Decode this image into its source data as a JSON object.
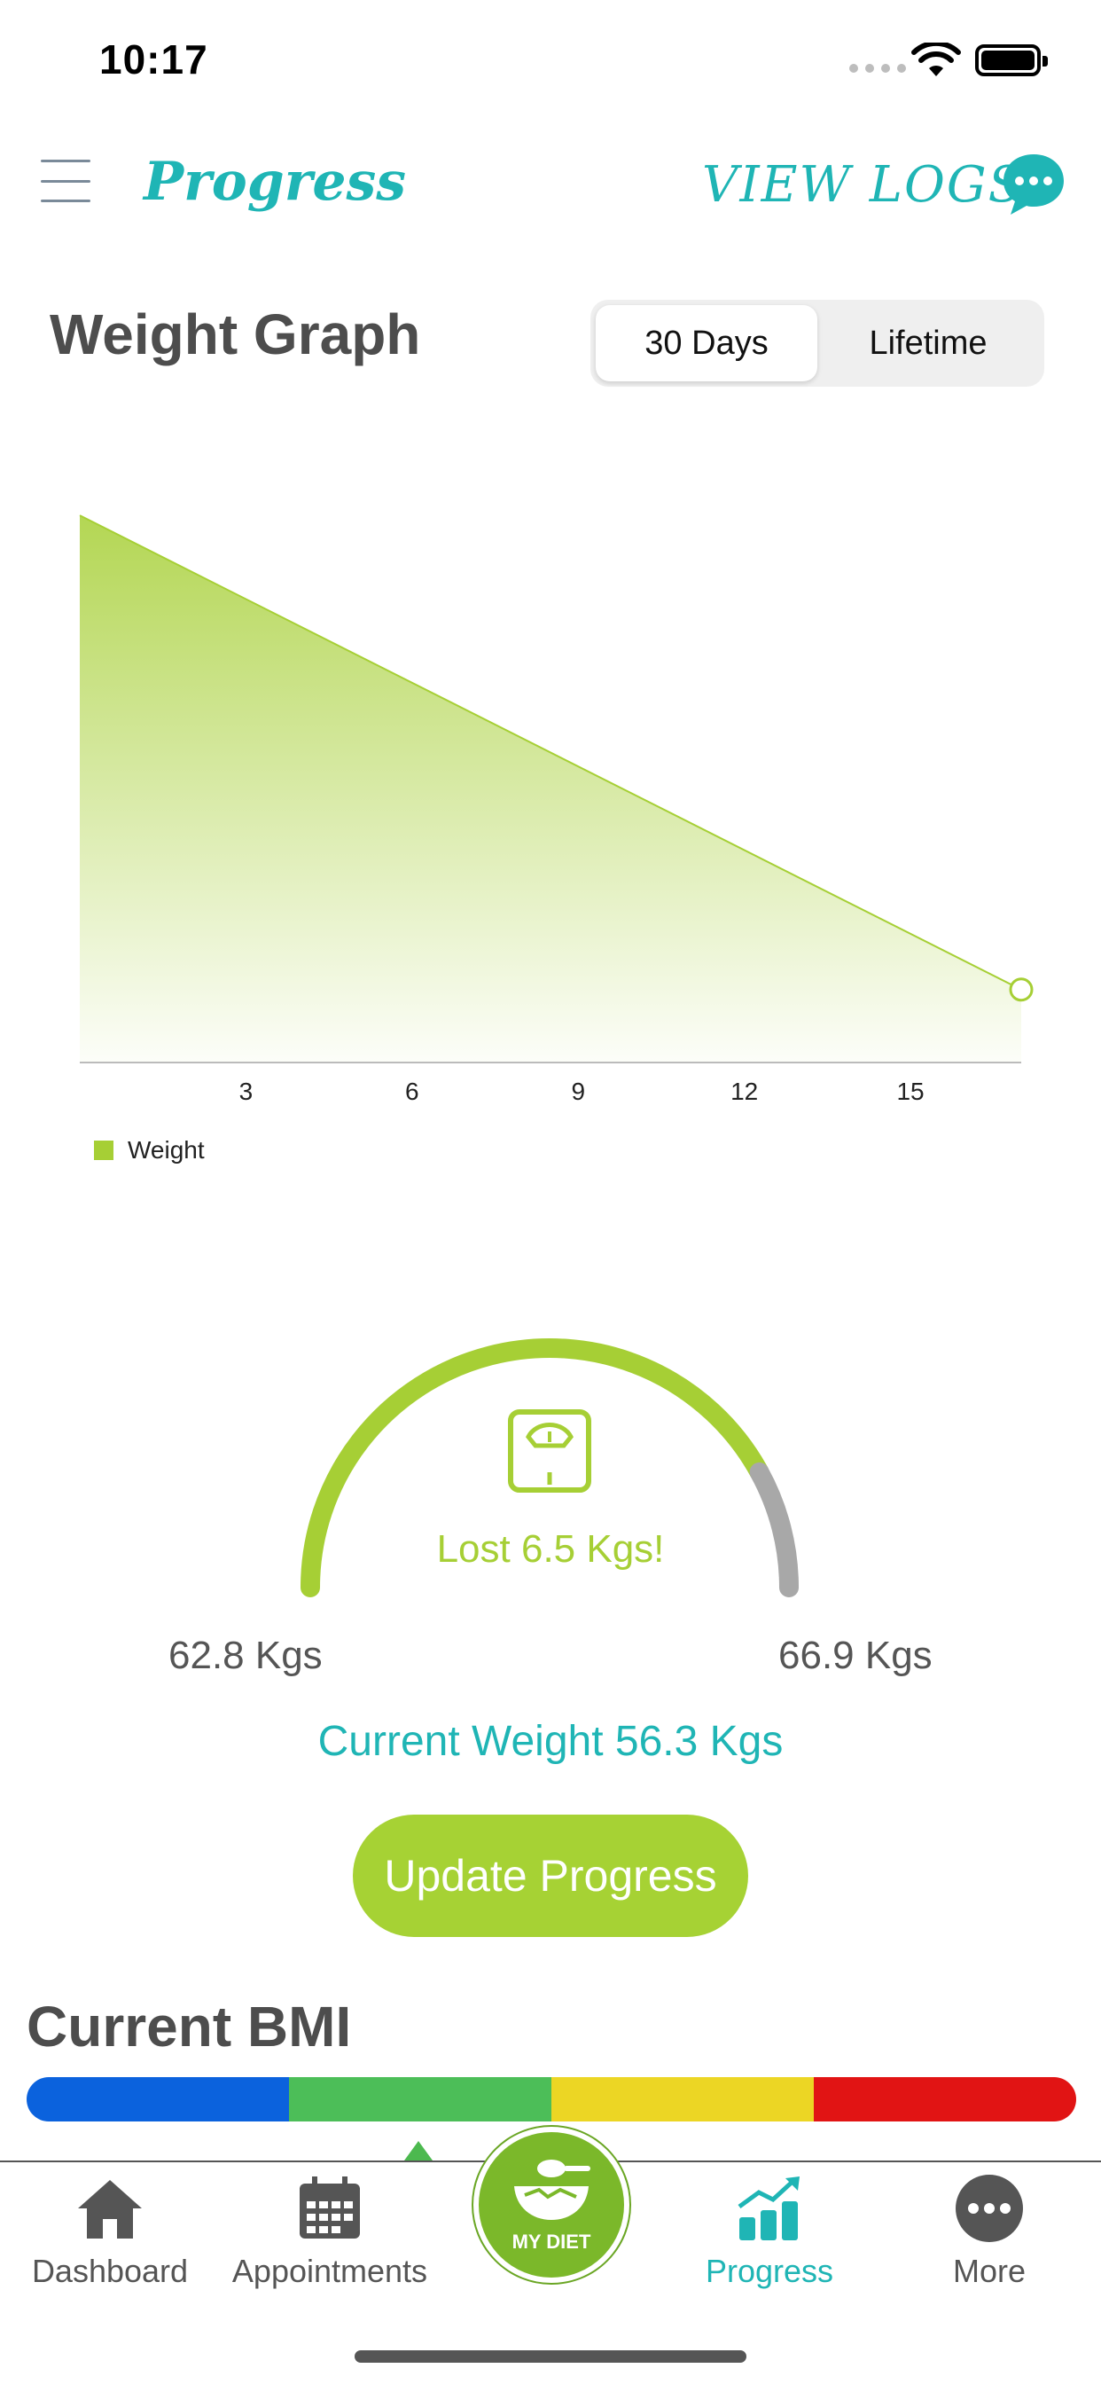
{
  "status_bar": {
    "time": "10:17"
  },
  "header": {
    "title": "Progress",
    "view_logs": "VIEW LOGS"
  },
  "weight_graph": {
    "title": "Weight Graph",
    "segments": [
      "30 Days",
      "Lifetime"
    ],
    "selected_segment": "30 Days"
  },
  "chart_data": {
    "type": "area",
    "x": [
      0,
      17
    ],
    "series": [
      {
        "name": "Weight",
        "values": [
          62.8,
          56.3
        ]
      }
    ],
    "x_ticks": [
      "3",
      "6",
      "9",
      "12",
      "15"
    ],
    "xlim": [
      0,
      17
    ],
    "ylim": [
      55.3,
      63.3
    ],
    "legend": [
      "Weight"
    ],
    "legend_position": "bottom-left",
    "color": "#a6cf35",
    "grid": false
  },
  "gauge": {
    "lost_text": "Lost 6.5 Kgs!",
    "start_label": "62.8 Kgs",
    "end_label": "66.9 Kgs",
    "progress_fraction": 0.84,
    "fill_color": "#a6cf35",
    "track_color": "#a8a8a8",
    "icon": "scale-icon"
  },
  "current_weight": "Current Weight 56.3 Kgs",
  "update_button": "Update Progress",
  "bmi": {
    "title": "Current BMI",
    "bands": [
      "#0b62dd",
      "#4cbe58",
      "#ecd624",
      "#e11414"
    ],
    "marker_fraction": 0.22
  },
  "tabs": [
    {
      "label": "Dashboard",
      "icon": "home-icon"
    },
    {
      "label": "Appointments",
      "icon": "calendar-icon"
    },
    {
      "label": "Progress",
      "icon": "bar-chart-icon",
      "active": true
    },
    {
      "label": "More",
      "icon": "more-icon"
    }
  ],
  "diet_button": {
    "label": "MY DIET",
    "icon": "bowl-icon"
  }
}
